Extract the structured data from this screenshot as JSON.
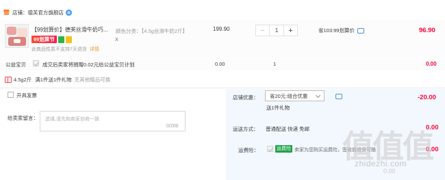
{
  "shop": {
    "label": "店铺：",
    "name": "德芙官方旗舰店"
  },
  "item": {
    "title": "【99划算价】德芙丝滑牛奶巧...",
    "tag_99": "99划算节",
    "return_notice": "此商品性质不支持7天退货",
    "detail_link": "详情",
    "sku_label": "颜色分类：【4.5g丝滑牛奶2斤】",
    "sku_extra": "X",
    "price": "199.90",
    "quantity": "1",
    "minus": "−",
    "plus": "+",
    "unit_price_text": "省103:99划算价",
    "subtotal": "96.90"
  },
  "charity": {
    "label": "公益宝贝",
    "text": "成交后卖家将捐赠0.02元给公益宝贝计划",
    "price": "0.00",
    "quantity": "1",
    "subtotal": "0.00"
  },
  "gift": {
    "sku": "4.5g2斤",
    "text": "满1件送1件礼物",
    "note": "无其他赠品可换"
  },
  "invoice": {
    "label": "开具发票"
  },
  "message": {
    "label": "给卖家留言：",
    "placeholder": "选填,请先和商家协商一致",
    "count": "0/200"
  },
  "discount": {
    "label": "店铺优惠：",
    "selected": "省20元:组合优惠",
    "amount": "-20.00",
    "sub_note": "送1件礼物"
  },
  "shipping": {
    "label": "运送方式：",
    "method": "普通配送 快递 免邮",
    "amount": "0.00"
  },
  "insurance": {
    "label": "运费险：",
    "tag": "运费险",
    "text": "卖家为您购买运费险，签收前退货可赔",
    "amount": "0.00"
  },
  "bottom_total": "0.00",
  "watermark": {
    "main": "值值值",
    "sub": "zhidezhi.com"
  },
  "colors": {
    "accent_red": "#ff0036",
    "insurance_green": "#1fa34a",
    "panel_bg": "#f3f8fe"
  }
}
